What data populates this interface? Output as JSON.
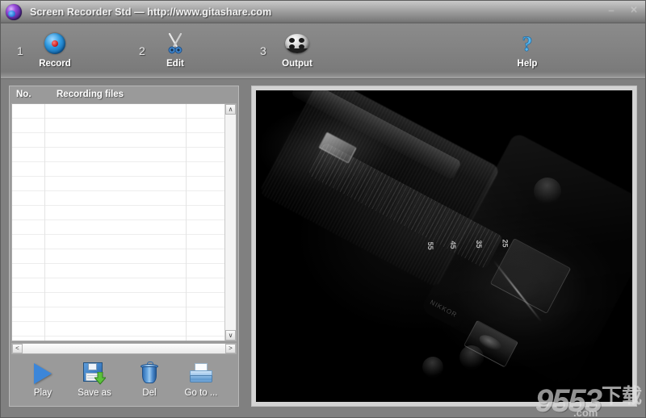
{
  "window": {
    "title": "Screen Recorder Std — http://www.gitashare.com",
    "app_icon": "app-sphere-icon",
    "controls": [
      {
        "name": "minimize",
        "glyph": "–"
      },
      {
        "name": "close",
        "glyph": "✕"
      }
    ]
  },
  "toolbar": {
    "steps": [
      {
        "number": "1",
        "label": "Record",
        "icon": "record-disc-icon"
      },
      {
        "number": "2",
        "label": "Edit",
        "icon": "scissors-icon"
      },
      {
        "number": "3",
        "label": "Output",
        "icon": "film-reel-icon"
      }
    ],
    "help": {
      "label": "Help",
      "icon": "question-mark-icon"
    }
  },
  "file_list": {
    "columns": [
      "No.",
      "Recording files"
    ],
    "rows": [],
    "scroll": {
      "up": "∧",
      "down": "∨",
      "left": "<",
      "right": ">"
    }
  },
  "actions": [
    {
      "label": "Play",
      "icon": "play-triangle-icon"
    },
    {
      "label": "Save as",
      "icon": "floppy-save-icon"
    },
    {
      "label": "Del",
      "icon": "trash-can-icon"
    },
    {
      "label": "Go to ...",
      "icon": "open-folder-icon"
    }
  ],
  "preview": {
    "name": "video-preview",
    "content": "dark photograph of a DSLR camera and lens",
    "focal_marks": [
      "55",
      "45",
      "35",
      "25"
    ],
    "lens_stamp": "NIKKOR"
  },
  "watermark": {
    "number": "9553",
    "cn": "下载",
    "domain": ".com"
  },
  "colors": {
    "titlebar_top": "#c9c9c9",
    "titlebar_bottom": "#6f6f6f",
    "toolbar": "#848484",
    "panel": "#9a9a9a",
    "body": "#808080",
    "list_bg": "#ffffff",
    "accent_blue": "#3c86d9",
    "record_red": "#c21616",
    "preview_bg": "#000000"
  }
}
